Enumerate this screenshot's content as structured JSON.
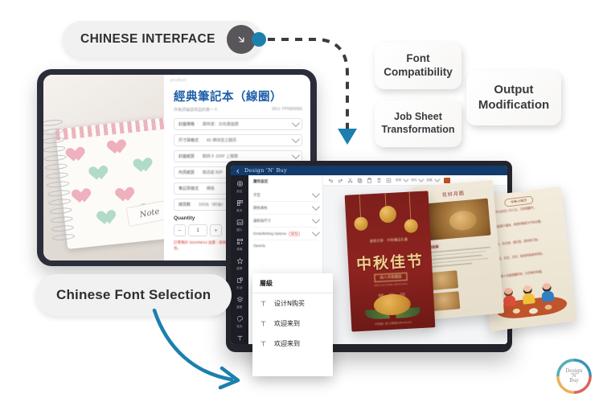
{
  "callouts": {
    "chinese_interface": {
      "label": "CHINESE INTERFACE",
      "arrow_icon": "arrow-down-right-icon"
    },
    "chinese_font_selection": {
      "label": "Chinese Font Selection"
    }
  },
  "feature_cards": [
    {
      "id": "font-compatibility",
      "line1": "Font",
      "line2": "Compatibility"
    },
    {
      "id": "job-sheet-transformation",
      "line1": "Job Sheet",
      "line2": "Transformation"
    },
    {
      "id": "output-modification",
      "line1": "Output",
      "line2": "Modification"
    }
  ],
  "tablet": {
    "browser_hint": "product",
    "product": {
      "title": "經典筆記本（線圈）",
      "subtitle_left": "作為評論該商品的第一人",
      "subtitle_right": "SKU: PPNBWBA",
      "options": [
        {
          "label": "封面規格",
          "value": "霧時書：白色霧面膜"
        },
        {
          "label": "尺寸與格式",
          "value": "A5 横排直立翻頁"
        },
        {
          "label": "封面紙質",
          "value": "鋼西卡 300P 上霧膜"
        },
        {
          "label": "內頁紙質",
          "value": "模造紙 80P"
        },
        {
          "label": "筆記頁樣式",
          "value": "横格"
        },
        {
          "label": "總頁數",
          "value": "160頁（80張）"
        }
      ],
      "quantity": {
        "label": "Quantity",
        "minus": "−",
        "value": "1",
        "plus": "+"
      },
      "warning": "訂單預計 2024/06/14 出貨｜如有急件需求請先洽詢客服確認可行性，感謝配合。"
    }
  },
  "laptop": {
    "app_name": "Design 'N' Buy",
    "rail_items": [
      {
        "icon": "settings-icon",
        "label": "設定"
      },
      {
        "icon": "template-icon",
        "label": "範本"
      },
      {
        "icon": "image-icon",
        "label": "圖片"
      },
      {
        "icon": "qr-icon",
        "label": "條碼"
      },
      {
        "icon": "clipart-icon",
        "label": "圖庫"
      },
      {
        "icon": "shapes-icon",
        "label": "形狀"
      },
      {
        "icon": "layers-icon",
        "label": "圖層"
      },
      {
        "icon": "color-icon",
        "label": "色彩"
      },
      {
        "icon": "text-icon",
        "label": "文字"
      }
    ],
    "properties": {
      "header": "屬性設定",
      "rows": [
        {
          "label": "字型",
          "control": "chevron-down-icon"
        },
        {
          "label": "顏色填色",
          "control": "chevron-down-icon"
        },
        {
          "label": "邊框與尺寸",
          "control": "chevron-down-icon"
        },
        {
          "label": "Embellishing Options",
          "badge": "BETA",
          "control": "chevron-down-icon"
        },
        {
          "label": "Opacity",
          "control": ""
        }
      ]
    },
    "toolbar": {
      "icons": [
        "undo-icon",
        "redo-icon",
        "cut-icon",
        "copy-icon",
        "paste-icon",
        "delete-icon",
        "duplicate-icon"
      ],
      "selects": [
        "對齊",
        "排列",
        "效果"
      ],
      "swatch_color": "#c2511c"
    },
    "font_panel": {
      "header": "層級",
      "items": [
        {
          "icon": "text-icon",
          "label": "设计N购买"
        },
        {
          "icon": "text-icon",
          "label": "欢迎来到"
        },
        {
          "icon": "text-icon",
          "label": "欢迎来到"
        }
      ]
    }
  },
  "designs": {
    "flyer": {
      "logo": "泰悦月饼 · 中秋臻品礼盒",
      "title": "中秋佳节",
      "ribbon": "與人月兩團圓",
      "subtitle": "MID-AUTUMN FESTIVAL",
      "chips": [
        "甄選",
        "臻味",
        "共賞"
      ],
      "footer": "門市據點／線上訂購專線 0800-000-000"
    },
    "middle": {
      "header": "花好月圆",
      "section": "月饼故事"
    },
    "right": {
      "header": "中秋小知识",
      "items": [
        "中秋节为农历八月十五，又称团圆节。",
        "月饼起源于唐宋，明清时期成为节庆必备。",
        "赏月、吃月饼、提灯笼，是传统习俗。",
        "广式、苏式、京式，各地风味各有特色。",
        "与家人共度团圆时刻，分享美好祝福。"
      ]
    }
  },
  "watermark": {
    "line1": "Design",
    "line2": "'N'",
    "line3": "Buy"
  },
  "colors": {
    "accent_blue": "#1c7fae",
    "dark": "#58565a",
    "brand_navy": "#123a6b",
    "warn_red": "#d4332e"
  }
}
